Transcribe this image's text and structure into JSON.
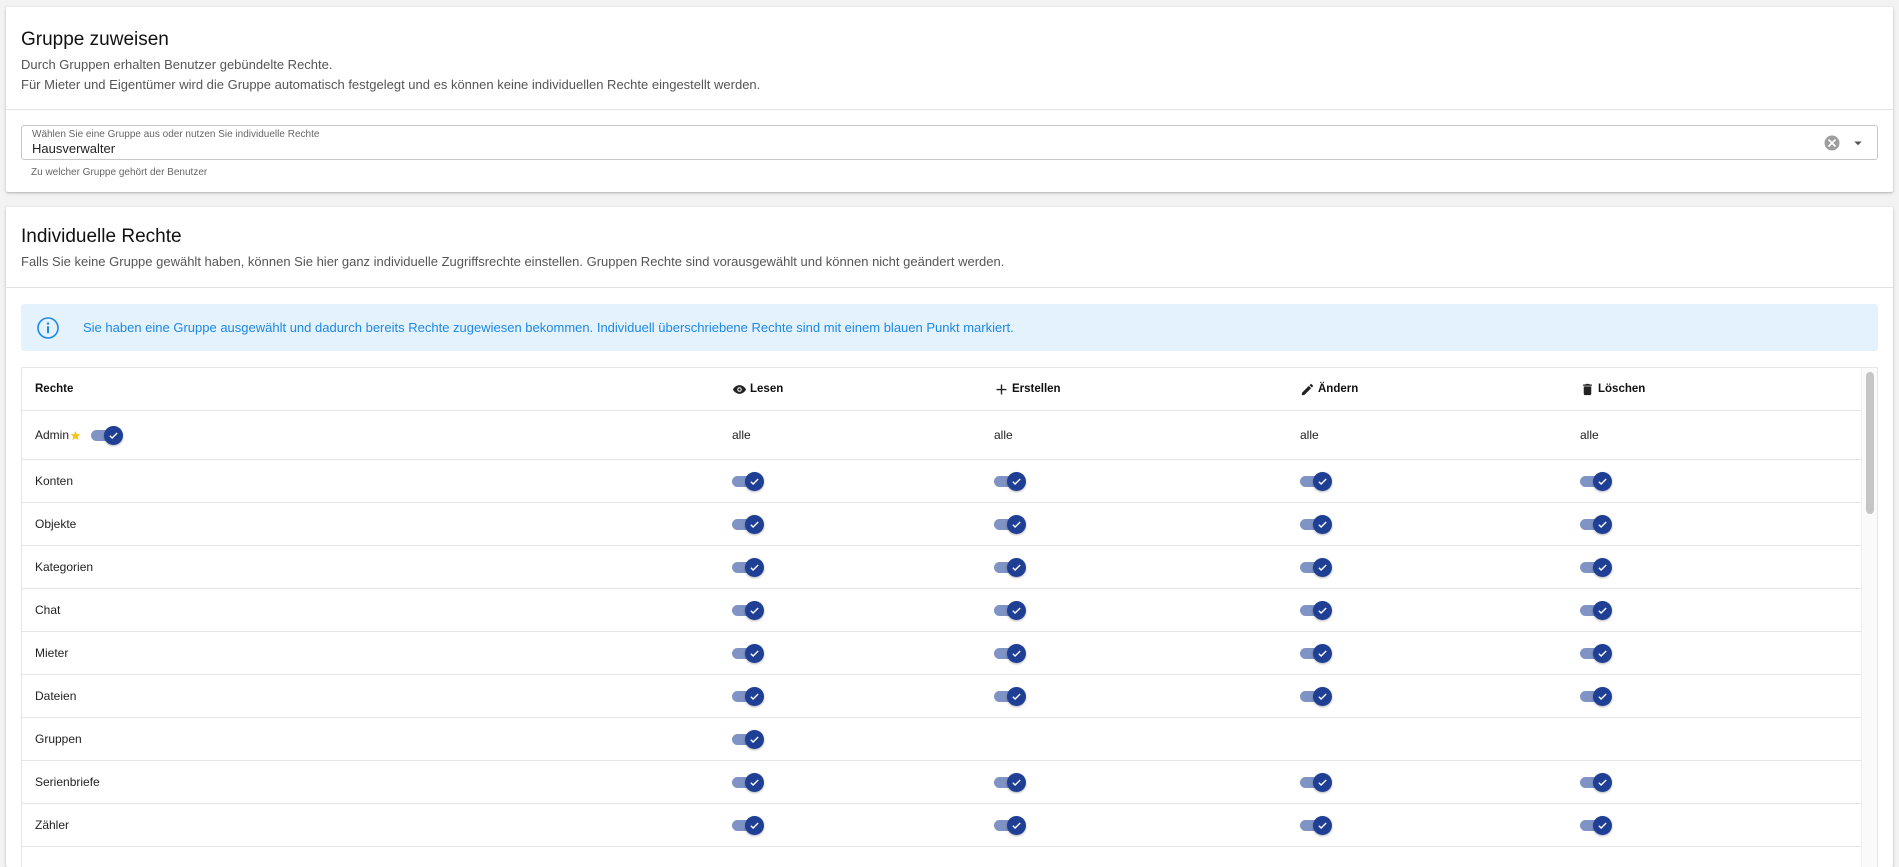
{
  "group_card": {
    "title": "Gruppe zuweisen",
    "desc_line1": "Durch Gruppen erhalten Benutzer gebündelte Rechte.",
    "desc_line2": "Für Mieter und Eigentümer wird die Gruppe automatisch festgelegt und es können keine individuellen Rechte eingestellt werden.",
    "select_label": "Wählen Sie eine Gruppe aus oder nutzen Sie individuelle Rechte",
    "select_value": "Hausverwalter",
    "select_hint": "Zu welcher Gruppe gehört der Benutzer"
  },
  "rights_card": {
    "title": "Individuelle Rechte",
    "desc": "Falls Sie keine Gruppe gewählt haben, können Sie hier ganz individuelle Zugriffsrechte einstellen. Gruppen Rechte sind vorausgewählt und können nicht geändert werden.",
    "alert_text": "Sie haben eine Gruppe ausgewählt und dadurch bereits Rechte zugewiesen bekommen. Individuell überschriebene Rechte sind mit einem blauen Punkt markiert."
  },
  "table": {
    "headers": {
      "rights": "Rechte",
      "read": "Lesen",
      "create": "Erstellen",
      "edit": "Ändern",
      "delete": "Löschen"
    },
    "admin_row": {
      "label": "Admin",
      "read": "alle",
      "create": "alle",
      "edit": "alle",
      "delete": "alle"
    },
    "rows": [
      {
        "label": "Konten",
        "read": true,
        "create": true,
        "edit": true,
        "delete": true
      },
      {
        "label": "Objekte",
        "read": true,
        "create": true,
        "edit": true,
        "delete": true
      },
      {
        "label": "Kategorien",
        "read": true,
        "create": true,
        "edit": true,
        "delete": true
      },
      {
        "label": "Chat",
        "read": true,
        "create": true,
        "edit": true,
        "delete": true
      },
      {
        "label": "Mieter",
        "read": true,
        "create": true,
        "edit": true,
        "delete": true
      },
      {
        "label": "Dateien",
        "read": true,
        "create": true,
        "edit": true,
        "delete": true
      },
      {
        "label": "Gruppen",
        "read": true,
        "create": false,
        "edit": false,
        "delete": false
      },
      {
        "label": "Serienbriefe",
        "read": true,
        "create": true,
        "edit": true,
        "delete": true
      },
      {
        "label": "Zähler",
        "read": true,
        "create": true,
        "edit": true,
        "delete": true
      }
    ]
  },
  "colors": {
    "toggle_knob": "#1f3f94",
    "toggle_track": "#7f93c5",
    "alert_bg": "#e3f2fc",
    "alert_text": "#1e88e5",
    "star": "#f5c518"
  }
}
